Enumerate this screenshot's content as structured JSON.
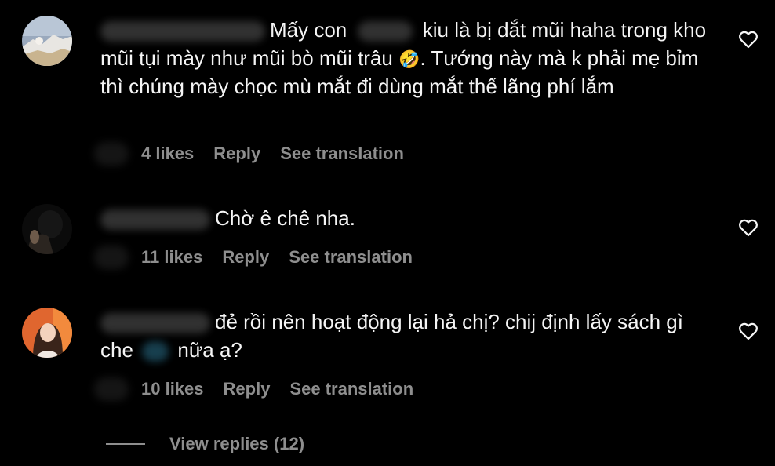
{
  "comments": [
    {
      "text_before": "Mấy con",
      "text_after": "kiu là bị dắt mũi haha trong kho mũi tụi mày như mũi bò mũi trâu",
      "emoji": "🤣",
      "text_end": ". Tướng này mà k phải mẹ bỉm thì chúng mày chọc mù mắt đi dùng mắt thế lãng phí lắm",
      "likes": "4 likes",
      "reply": "Reply",
      "translate": "See translation",
      "like_icon": "heart-outline-icon"
    },
    {
      "text": "Chờ ê chê nha.",
      "likes": "11 likes",
      "reply": "Reply",
      "translate": "See translation",
      "like_icon": "heart-outline-icon"
    },
    {
      "text_before": "đẻ rồi nên hoạt động lại hả chị? chij định lấy sách gì che",
      "text_after": "nữa ạ?",
      "likes": "10 likes",
      "reply": "Reply",
      "translate": "See translation",
      "like_icon": "heart-outline-icon"
    }
  ],
  "view_replies": "View replies (12)",
  "colors": {
    "background": "#000000",
    "text": "#f5f5f5",
    "secondary": "#8e8e8e"
  }
}
